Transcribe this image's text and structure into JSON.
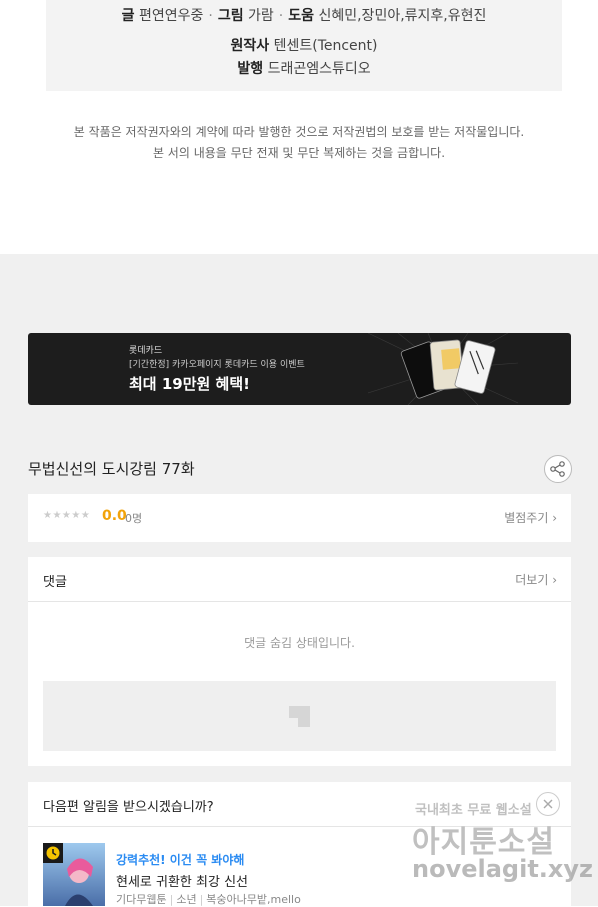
{
  "credits": {
    "line1": {
      "writer_label": "글",
      "writer": "편연연우중",
      "art_label": "그림",
      "art": "가람",
      "assist_label": "도움",
      "assist": "신혜민,장민아,류지후,유현진",
      "sep": "·"
    },
    "original_label": "원작사",
    "original": "텐센트(Tencent)",
    "publisher_label": "발행",
    "publisher": "드래곤엠스튜디오"
  },
  "notice": {
    "line1": "본 작품은 저작권자와의 계약에 따라 발행한 것으로 저작권법의 보호를 받는 저작물입니다.",
    "line2": "본 서의 내용을 무단 전재 및 무단 복제하는 것을 금합니다."
  },
  "banner": {
    "brand": "롯데카드",
    "sub": "[기간한정] 카카오페이지 롯데카드 이용 이벤트",
    "headline": "최대 19만원 혜택!"
  },
  "episode": {
    "title": "무법신선의 도시강림 77화"
  },
  "rating": {
    "stars": "★★★★★",
    "score": "0.0",
    "voters": "0명",
    "rate_link": "별점주기 ›"
  },
  "comments": {
    "title": "댓글",
    "more": "더보기 ›",
    "hidden_msg": "댓글 숨김 상태입니다."
  },
  "alert": {
    "title": "다음편 알림을 받으시겠습니까?",
    "recommend": {
      "tag": "강력추천! 이건 꼭 봐야해",
      "title": "현세로 귀환한 최강 신선",
      "genre": "기다무웹툰",
      "category": "소년",
      "authors": "복숭아나무밭,mello"
    }
  },
  "watermark": {
    "line1": "국내최초 무료 웹소설",
    "line2": "아지툰소설",
    "line3": "novelagit.xyz"
  },
  "colors": {
    "score": "#f2a30a",
    "tag": "#2a8bf2",
    "banner_bg": "#1d1d1d",
    "page_gray": "#f0f0f0"
  }
}
